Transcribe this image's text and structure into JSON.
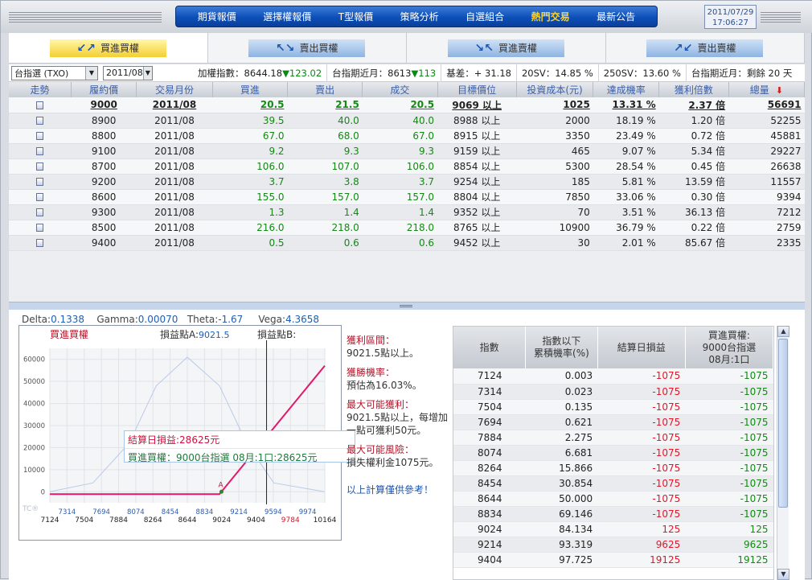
{
  "nav": {
    "items": [
      "期貨報價",
      "選擇權報價",
      "T型報價",
      "策略分析",
      "自選組合",
      "熱門交易",
      "最新公告"
    ],
    "active": "熱門交易"
  },
  "clock": {
    "date": "2011/07/29",
    "time": "17:06:27"
  },
  "tabs": [
    {
      "label": "買進買權",
      "active": true
    },
    {
      "label": "賣出買權",
      "active": false
    },
    {
      "label": "買進賣權",
      "active": false
    },
    {
      "label": "賣出賣權",
      "active": false
    }
  ],
  "info": {
    "product": "台指選 (TXO)",
    "month": "2011/08",
    "weighted_index": "加權指數：8644.18",
    "weighted_change": "▼123.02",
    "near_month": "台指期近月：8613",
    "near_change": "▼113",
    "basis": "基差：+ 31.18",
    "sv20": "20SV：14.85 %",
    "sv250": "250SV：13.60 %",
    "remaining": "台指期近月：剩餘 20 天"
  },
  "table": {
    "headers": [
      "走勢",
      "履約價",
      "交易月份",
      "買進",
      "賣出",
      "成交",
      "目標價位",
      "投資成本(元)",
      "達成機率",
      "獲利倍數",
      "總量"
    ],
    "rows": [
      [
        "9000",
        "2011/08",
        "20.5",
        "21.5",
        "20.5",
        "9069 以上",
        "1025",
        "13.31 %",
        "2.37 倍",
        "56691"
      ],
      [
        "8900",
        "2011/08",
        "39.5",
        "40.0",
        "40.0",
        "8988 以上",
        "2000",
        "18.19 %",
        "1.20 倍",
        "52255"
      ],
      [
        "8800",
        "2011/08",
        "67.0",
        "68.0",
        "67.0",
        "8915 以上",
        "3350",
        "23.49 %",
        "0.72 倍",
        "45881"
      ],
      [
        "9100",
        "2011/08",
        "9.2",
        "9.3",
        "9.3",
        "9159 以上",
        "465",
        "9.07 %",
        "5.34 倍",
        "29227"
      ],
      [
        "8700",
        "2011/08",
        "106.0",
        "107.0",
        "106.0",
        "8854 以上",
        "5300",
        "28.54 %",
        "0.45 倍",
        "26638"
      ],
      [
        "9200",
        "2011/08",
        "3.7",
        "3.8",
        "3.7",
        "9254 以上",
        "185",
        "5.81 %",
        "13.59 倍",
        "11557"
      ],
      [
        "8600",
        "2011/08",
        "155.0",
        "157.0",
        "157.0",
        "8804 以上",
        "7850",
        "33.06 %",
        "0.30 倍",
        "9394"
      ],
      [
        "9300",
        "2011/08",
        "1.3",
        "1.4",
        "1.4",
        "9352 以上",
        "70",
        "3.51 %",
        "36.13 倍",
        "7212"
      ],
      [
        "8500",
        "2011/08",
        "216.0",
        "218.0",
        "218.0",
        "8765 以上",
        "10900",
        "36.79 %",
        "0.22 倍",
        "2759"
      ],
      [
        "9400",
        "2011/08",
        "0.5",
        "0.6",
        "0.6",
        "9452 以上",
        "30",
        "2.01 %",
        "85.67 倍",
        "2335"
      ]
    ]
  },
  "greeks": {
    "delta": "0.1338",
    "gamma": "0.00070",
    "theta": "-1.67",
    "vega": "4.3658"
  },
  "chart": {
    "title": "買進買權",
    "be_a_label": "損益點A:",
    "be_a_value": "9021.5",
    "be_b_label": "損益點B:",
    "tip1": "結算日損益:28625元",
    "tip2": "買進買權：9000台指選 08月:1口:28625元",
    "point_label": "A",
    "watermark": "TC®"
  },
  "chart_data": {
    "type": "line",
    "x_ticks_bottom": [
      "7124",
      "7504",
      "7884",
      "8264",
      "8644",
      "9024",
      "9404",
      "9784",
      "10164"
    ],
    "x_ticks_top": [
      "7314",
      "7694",
      "8074",
      "8454",
      "8834",
      "9214",
      "9594",
      "9974"
    ],
    "y_ticks": [
      "60000",
      "50000",
      "40000",
      "30000",
      "20000",
      "10000",
      "0"
    ],
    "xlim": [
      7124,
      10164
    ],
    "ylim": [
      -5000,
      65000
    ],
    "pl_series": {
      "x": [
        7124,
        9000,
        9021.5,
        10164
      ],
      "y": [
        -1075,
        -1075,
        0,
        57125
      ]
    },
    "dist_series": {
      "x": [
        7124,
        7600,
        8000,
        8300,
        8644,
        9000,
        9300,
        9600,
        10164
      ],
      "y": [
        0,
        4000,
        22000,
        48000,
        61000,
        48000,
        22000,
        4000,
        0
      ]
    },
    "cursor_x": 9520,
    "colors": {
      "pl": "#e3186a",
      "dist": "#b9cbe9",
      "cursor": "#222"
    }
  },
  "textpanel": [
    {
      "h": "獲利區間：",
      "b": "9021.5點以上。"
    },
    {
      "h": "獲勝機率：",
      "b": "預估為16.03%。"
    },
    {
      "h": "最大可能獲利：",
      "b": "9021.5點以上，每增加一點可獲利50元。"
    },
    {
      "h": "最大可能風險：",
      "b": "損失權利金1075元。"
    }
  ],
  "note": "以上計算僅供參考！",
  "pltable": {
    "headers": [
      "指數",
      "指數以下\n累積機率(%)",
      "結算日損益",
      "買進買權:\n9000台指選\n08月:1口"
    ],
    "rows": [
      [
        "7124",
        "0.003",
        "-1075",
        "-1075"
      ],
      [
        "7314",
        "0.023",
        "-1075",
        "-1075"
      ],
      [
        "7504",
        "0.135",
        "-1075",
        "-1075"
      ],
      [
        "7694",
        "0.621",
        "-1075",
        "-1075"
      ],
      [
        "7884",
        "2.275",
        "-1075",
        "-1075"
      ],
      [
        "8074",
        "6.681",
        "-1075",
        "-1075"
      ],
      [
        "8264",
        "15.866",
        "-1075",
        "-1075"
      ],
      [
        "8454",
        "30.854",
        "-1075",
        "-1075"
      ],
      [
        "8644",
        "50.000",
        "-1075",
        "-1075"
      ],
      [
        "8834",
        "69.146",
        "-1075",
        "-1075"
      ],
      [
        "9024",
        "84.134",
        "125",
        "125"
      ],
      [
        "9214",
        "93.319",
        "9625",
        "9625"
      ],
      [
        "9404",
        "97.725",
        "19125",
        "19125"
      ]
    ]
  }
}
